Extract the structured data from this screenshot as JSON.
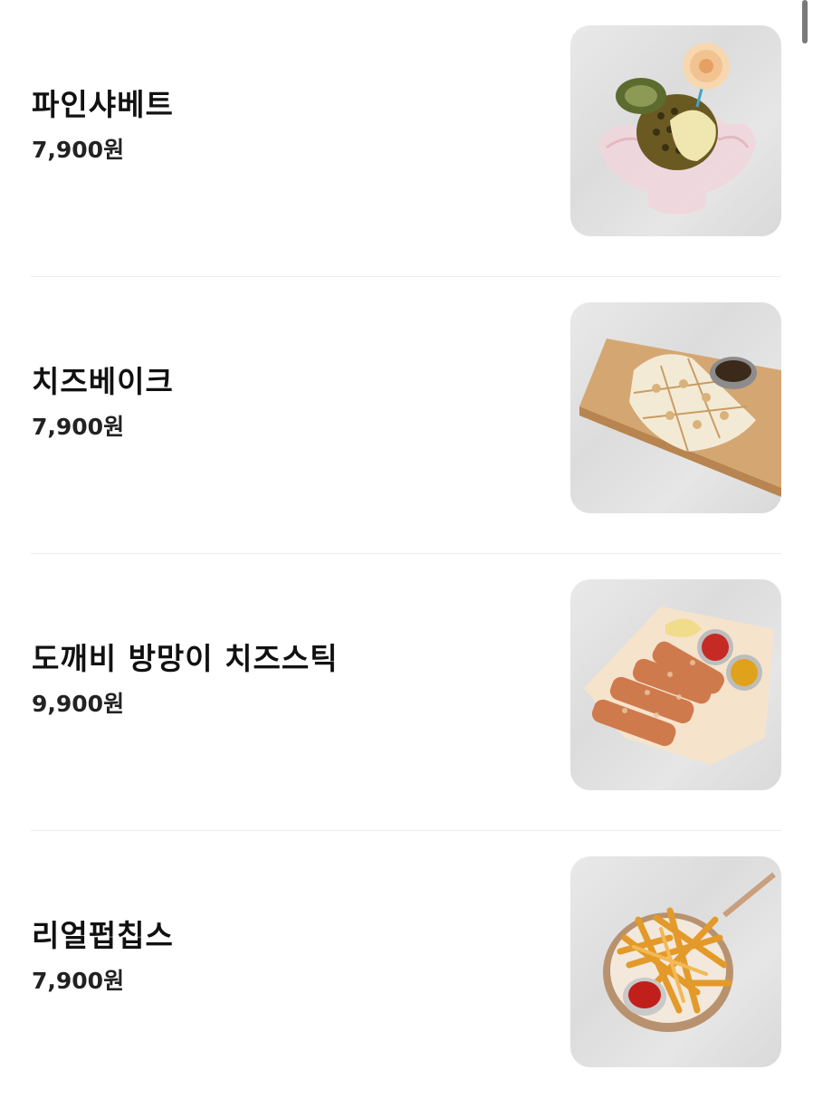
{
  "menu": {
    "items": [
      {
        "name": "파인샤베트",
        "price": "7,900원",
        "image_icon": "pineapple-sorbet-photo"
      },
      {
        "name": "치즈베이크",
        "price": "7,900원",
        "image_icon": "cheese-bake-photo"
      },
      {
        "name": "도깨비 방망이 치즈스틱",
        "price": "9,900원",
        "image_icon": "cheese-stick-photo"
      },
      {
        "name": "리얼펍칩스",
        "price": "7,900원",
        "image_icon": "fries-photo"
      }
    ]
  }
}
